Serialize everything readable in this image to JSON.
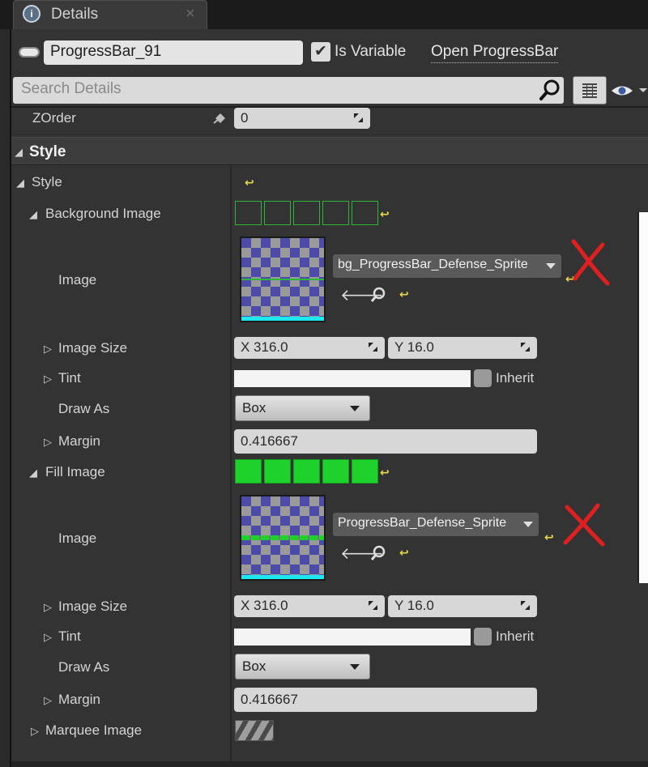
{
  "tab": {
    "title": "Details",
    "icon": "info-icon",
    "close": "×"
  },
  "header": {
    "widget_name": "ProgressBar_91",
    "is_variable_label": "Is Variable",
    "is_variable_checked": true,
    "open_link": "Open ProgressBar"
  },
  "search": {
    "placeholder": "Search Details"
  },
  "zorder": {
    "label": "ZOrder",
    "value": "0"
  },
  "section": {
    "title": "Style"
  },
  "style_group": {
    "label": "Style"
  },
  "background": {
    "label": "Background Image",
    "image_label": "Image",
    "asset": "bg_ProgressBar_Defense_Sprite",
    "image_size_label": "Image Size",
    "size_x": "X  316.0",
    "size_y": "Y  16.0",
    "tint_label": "Tint",
    "inherit_label": "Inherit",
    "draw_as_label": "Draw As",
    "draw_as_value": "Box",
    "margin_label": "Margin",
    "margin_value": "0.416667"
  },
  "fill": {
    "label": "Fill Image",
    "image_label": "Image",
    "asset": "ProgressBar_Defense_Sprite",
    "image_size_label": "Image Size",
    "size_x": "X  316.0",
    "size_y": "Y  16.0",
    "tint_label": "Tint",
    "inherit_label": "Inherit",
    "draw_as_label": "Draw As",
    "draw_as_value": "Box",
    "margin_label": "Margin",
    "margin_value": "0.416667"
  },
  "marquee": {
    "label": "Marquee Image"
  },
  "colors": {
    "accent_green": "#1ed12b",
    "outline_green": "#2fb53a",
    "cyan": "#1de8f0",
    "red_mark": "#e02020"
  }
}
